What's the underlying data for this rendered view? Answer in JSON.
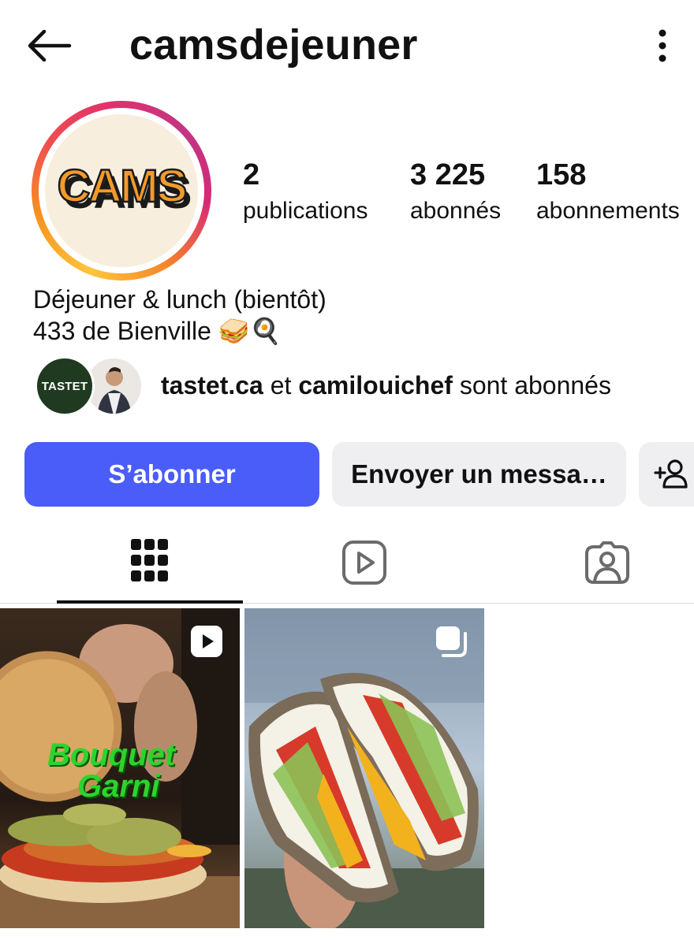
{
  "header": {
    "username": "camsdejeuner",
    "back_icon": "arrow-left-icon",
    "more_icon": "kebab-menu-icon"
  },
  "profile": {
    "avatar_text": "CAMS",
    "stats": {
      "posts": {
        "value": "2",
        "label": "publications"
      },
      "followers": {
        "value": "3 225",
        "label": "abonnés"
      },
      "following": {
        "value": "158",
        "label": "abonnements"
      }
    },
    "bio": {
      "line1": "Déjeuner & lunch (bientôt)",
      "line2": "433 de Bienville 🥪🍳"
    },
    "followed_by": {
      "avatar1_text": "TASTET",
      "user1": "tastet.ca",
      "connector": " et ",
      "user2": "camilouichef",
      "suffix": " sont abonnés"
    }
  },
  "actions": {
    "follow_label": "S’abonner",
    "message_label": "Envoyer un messa…",
    "add_user_icon": "add-user-icon"
  },
  "tabs": {
    "grid_icon": "grid-icon",
    "reels_icon": "reels-icon",
    "tagged_icon": "tagged-icon"
  },
  "posts": [
    {
      "type": "reel",
      "overlay_text_1": "Bouquet",
      "overlay_text_2": "Garni",
      "badge_icon": "reel-play-icon"
    },
    {
      "type": "carousel",
      "badge_icon": "carousel-icon"
    }
  ],
  "colors": {
    "accent": "#4a5df9",
    "secondary_button": "#efeff2",
    "text": "#111111"
  }
}
